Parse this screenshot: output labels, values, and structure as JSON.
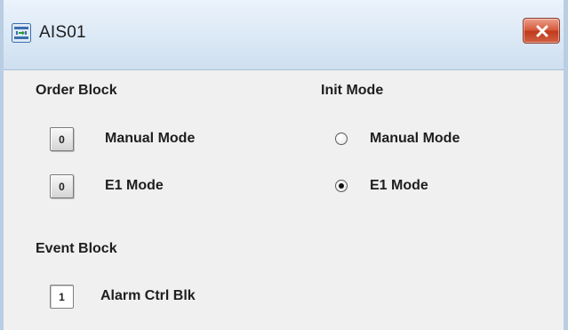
{
  "window": {
    "title": "AIS01",
    "icon": "link-icon",
    "close_icon": "close-icon",
    "close_color": "#d05336"
  },
  "order_block": {
    "heading": "Order Block",
    "items": [
      {
        "value": "0",
        "label": "Manual Mode"
      },
      {
        "value": "0",
        "label": "E1 Mode"
      }
    ]
  },
  "init_mode": {
    "heading": "Init Mode",
    "options": [
      {
        "label": "Manual Mode",
        "checked": false
      },
      {
        "label": "E1 Mode",
        "checked": true
      }
    ]
  },
  "event_block": {
    "heading": "Event Block",
    "items": [
      {
        "value": "1",
        "label": "Alarm Ctrl Blk"
      }
    ]
  }
}
